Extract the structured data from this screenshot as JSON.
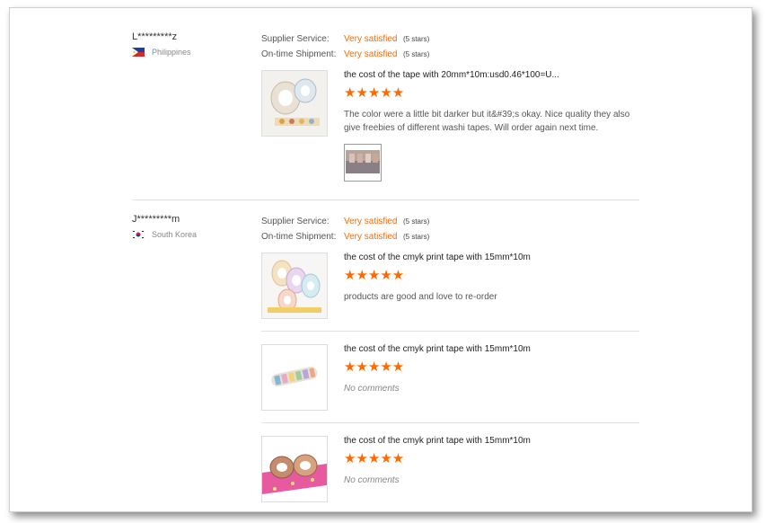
{
  "reviews": [
    {
      "buyer": "L*********z",
      "country": "Philippines",
      "supplier_service_label": "Supplier Service:",
      "supplier_service_value": "Very satisfied",
      "supplier_service_stars": "(5 stars)",
      "shipment_label": "On-time Shipment:",
      "shipment_value": "Very satisfied",
      "shipment_stars": "(5 stars)",
      "items": [
        {
          "title": "the cost of the tape with 20mm*10m:usd0.46*100=U...",
          "rating": 5,
          "comment": "The color were a little bit darker but it&#39;s okay. Nice quality they also give freebies of different washi tapes. Will order again next time."
        }
      ]
    },
    {
      "buyer": "J*********m",
      "country": "South Korea",
      "supplier_service_label": "Supplier Service:",
      "supplier_service_value": "Very satisfied",
      "supplier_service_stars": "(5 stars)",
      "shipment_label": "On-time Shipment:",
      "shipment_value": "Very satisfied",
      "shipment_stars": "(5 stars)",
      "items": [
        {
          "title": "the cost of the cmyk print tape with 15mm*10m",
          "rating": 5,
          "comment": "products are good and love to re-order"
        },
        {
          "title": "the cost of the cmyk print tape with 15mm*10m",
          "rating": 5,
          "comment": "No comments"
        },
        {
          "title": "the cost of the cmyk print tape with 15mm*10m",
          "rating": 5,
          "comment": "No comments"
        }
      ]
    }
  ],
  "stars_glyph": "★★★★★",
  "colors": {
    "accent": "#ff6a00"
  }
}
